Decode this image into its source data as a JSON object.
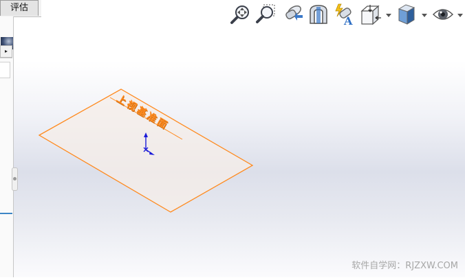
{
  "tabs": [
    {
      "label": "评估",
      "active": true
    }
  ],
  "left_panel": {
    "expand_glyph": "▸"
  },
  "heads_up_toolbar": {
    "buttons": [
      {
        "name": "zoom-to-fit",
        "icon": "zoom-fit-icon"
      },
      {
        "name": "zoom-to-area",
        "icon": "zoom-area-icon"
      },
      {
        "name": "previous-view",
        "icon": "previous-view-icon"
      },
      {
        "name": "section-view",
        "icon": "section-view-icon"
      },
      {
        "name": "dynamic-annotation-views",
        "icon": "annotation-views-icon"
      },
      {
        "name": "view-orientation",
        "icon": "view-orientation-icon",
        "has_dropdown": true
      },
      {
        "name": "display-style",
        "icon": "display-style-icon",
        "has_dropdown": true
      },
      {
        "name": "hide-show-items",
        "icon": "eye-icon",
        "has_dropdown": true
      }
    ]
  },
  "viewport": {
    "plane_label": "上视基准面",
    "plane_color": "#ff8a1e",
    "plane_fill": "#f6eee8",
    "triad_color": "#1a1ad8"
  },
  "watermark": "软件自学网：RJZXW.COM"
}
